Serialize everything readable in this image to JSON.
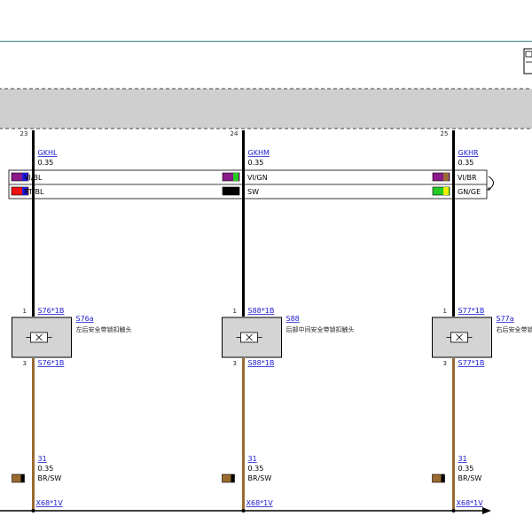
{
  "wire_table": {
    "row1": [
      {
        "label": "VI/BL",
        "colors": [
          "#8a1a8a",
          "#1a1ae0"
        ]
      },
      {
        "label": "VI/GN",
        "colors": [
          "#8a1a8a",
          "#22cc22"
        ]
      },
      {
        "label": "VI/BR",
        "colors": [
          "#8a1a8a",
          "#9a6a30"
        ]
      }
    ],
    "row2": [
      {
        "label": "RT/BL",
        "colors": [
          "#ee1111",
          "#1a1ae0"
        ]
      },
      {
        "label": "SW",
        "colors": [
          "#000000",
          "#000000"
        ]
      },
      {
        "label": "GN/GE",
        "colors": [
          "#22cc22",
          "#eeee00"
        ]
      }
    ]
  },
  "columns": [
    {
      "top_pin": "23",
      "signal": "GKHL",
      "gauge_top": "0.35",
      "pin_in": "1",
      "pin_in_label": "S76*1B",
      "component_id": "S76a",
      "component_name": "左后安全带锁扣触头",
      "pin_out": "3",
      "pin_out_label": "S76*1B",
      "ground_wire": "31",
      "gauge_bottom": "0.35",
      "bottom_color_label": "BR/SW",
      "bottom_colors": [
        "#9a6a30",
        "#000000"
      ],
      "connector": "X68*1V"
    },
    {
      "top_pin": "24",
      "signal": "GKHM",
      "gauge_top": "0.35",
      "pin_in": "1",
      "pin_in_label": "S88*1B",
      "component_id": "S88",
      "component_name": "后部中间安全带锁扣触头",
      "pin_out": "3",
      "pin_out_label": "S88*1B",
      "ground_wire": "31",
      "gauge_bottom": "0.35",
      "bottom_color_label": "BR/SW",
      "bottom_colors": [
        "#9a6a30",
        "#000000"
      ],
      "connector": "X68*1V"
    },
    {
      "top_pin": "25",
      "signal": "GKHR",
      "gauge_top": "0.35",
      "pin_in": "1",
      "pin_in_label": "S77*1B",
      "component_id": "S77a",
      "component_name": "右后安全带锁",
      "pin_out": "3",
      "pin_out_label": "S77*1B",
      "ground_wire": "31",
      "gauge_bottom": "0.35",
      "bottom_color_label": "BR/SW",
      "bottom_colors": [
        "#9a6a30",
        "#000000"
      ],
      "connector": "X68*1V"
    }
  ]
}
